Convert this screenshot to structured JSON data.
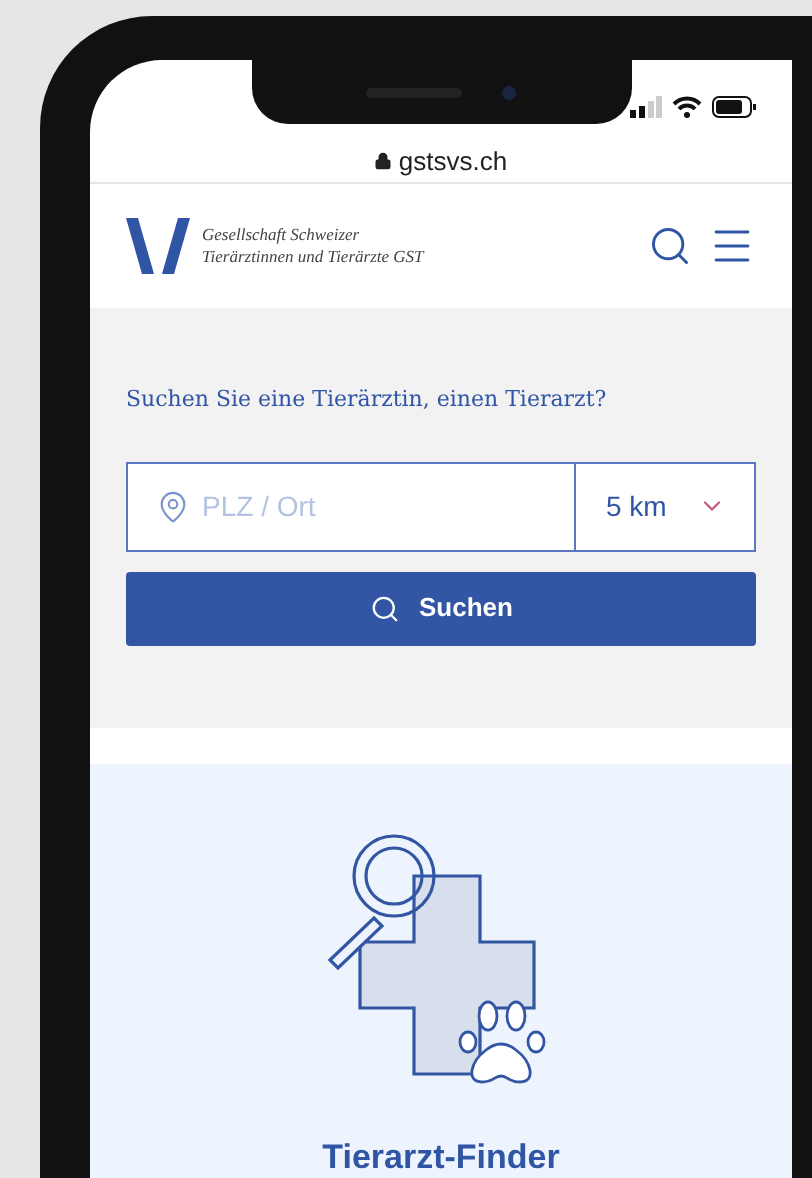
{
  "browser": {
    "url": "gstsvs.ch"
  },
  "header": {
    "logo_lines": [
      "Gesellschaft Schweizer",
      "Tierärztinnen und Tierärzte GST"
    ]
  },
  "search": {
    "question": "Suchen Sie eine Tierärztin, einen Tierarzt?",
    "location_placeholder": "PLZ / Ort",
    "distance": "5 km",
    "button": "Suchen"
  },
  "card": {
    "title": "Tierarzt-Finder"
  }
}
